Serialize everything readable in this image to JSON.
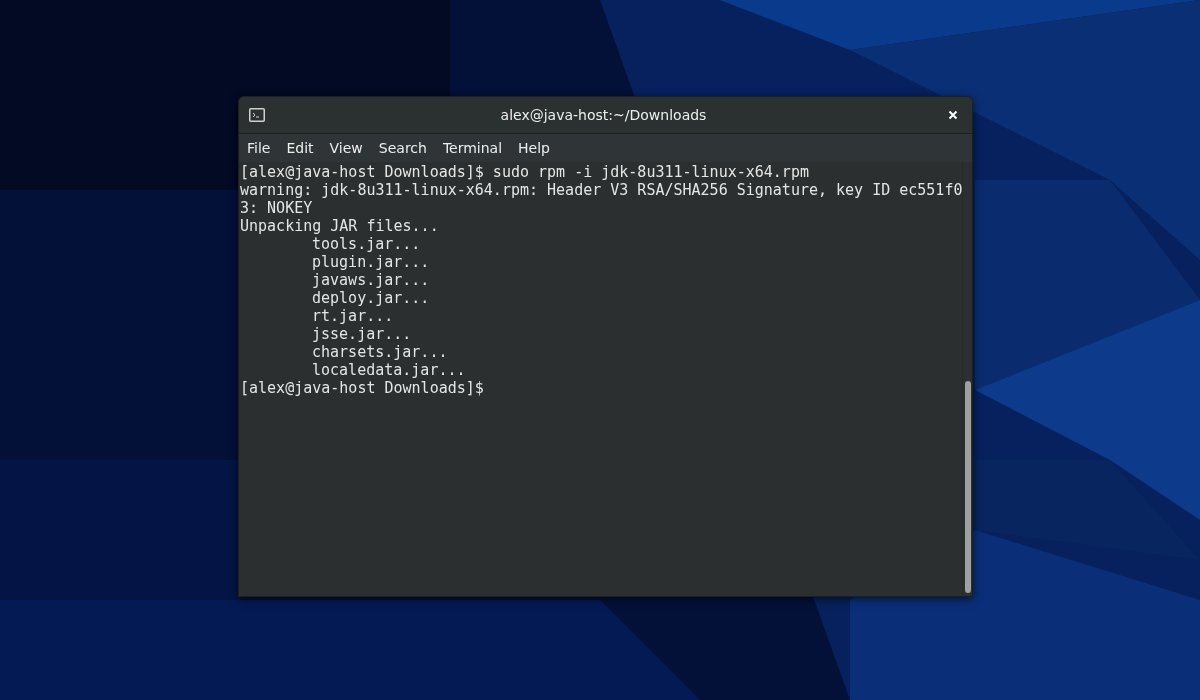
{
  "window": {
    "title": "alex@java-host:~/Downloads"
  },
  "menu": [
    "File",
    "Edit",
    "View",
    "Search",
    "Terminal",
    "Help"
  ],
  "terminal": {
    "lines": [
      {
        "kind": "plain",
        "text": "[alex@java-host Downloads]$ sudo rpm -i jdk-8u311-linux-x64.rpm"
      },
      {
        "kind": "plain",
        "text": "warning: jdk-8u311-linux-x64.rpm: Header V3 RSA/SHA256 Signature, key ID ec551f0"
      },
      {
        "kind": "plain",
        "text": "3: NOKEY"
      },
      {
        "kind": "plain",
        "text": "Unpacking JAR files..."
      },
      {
        "kind": "indented",
        "text": "tools.jar..."
      },
      {
        "kind": "indented",
        "text": "plugin.jar..."
      },
      {
        "kind": "indented",
        "text": "javaws.jar..."
      },
      {
        "kind": "indented",
        "text": "deploy.jar..."
      },
      {
        "kind": "indented",
        "text": "rt.jar..."
      },
      {
        "kind": "indented",
        "text": "jsse.jar..."
      },
      {
        "kind": "indented",
        "text": "charsets.jar..."
      },
      {
        "kind": "indented",
        "text": "localedata.jar..."
      },
      {
        "kind": "plain",
        "text": "[alex@java-host Downloads]$"
      }
    ]
  }
}
